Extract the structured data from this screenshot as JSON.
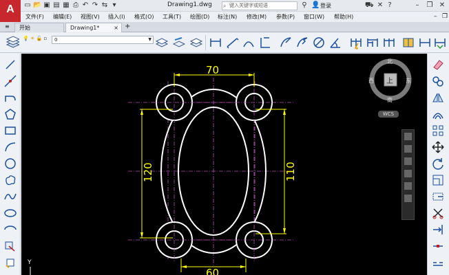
{
  "window": {
    "title": "Drawing1.dwg",
    "search_placeholder": "键入关键字或短语",
    "login_label": "登录"
  },
  "menu": [
    "文件(F)",
    "编辑(E)",
    "视图(V)",
    "插入(I)",
    "格式(O)",
    "工具(T)",
    "绘图(D)",
    "标注(N)",
    "修改(M)",
    "参数(P)",
    "窗口(W)",
    "帮助(H)"
  ],
  "tabs": [
    {
      "label": "开始",
      "active": false
    },
    {
      "label": "Drawing1*",
      "active": true
    }
  ],
  "layer": {
    "current": "0"
  },
  "viewcube": {
    "north": "北",
    "south": "南",
    "east": "东",
    "west": "西",
    "top": "上",
    "wcs_label": "WCS"
  },
  "ucs": {
    "y_label": "Y"
  },
  "dimensions": {
    "top_width": "70",
    "bottom_width": "60",
    "left_height": "120",
    "right_height": "110"
  },
  "colors": {
    "canvas_bg": "#000000",
    "geometry": "#ffffff",
    "dimension": "#ffff00",
    "centerline": "#b04fb0",
    "logo_red": "#c8282d"
  }
}
